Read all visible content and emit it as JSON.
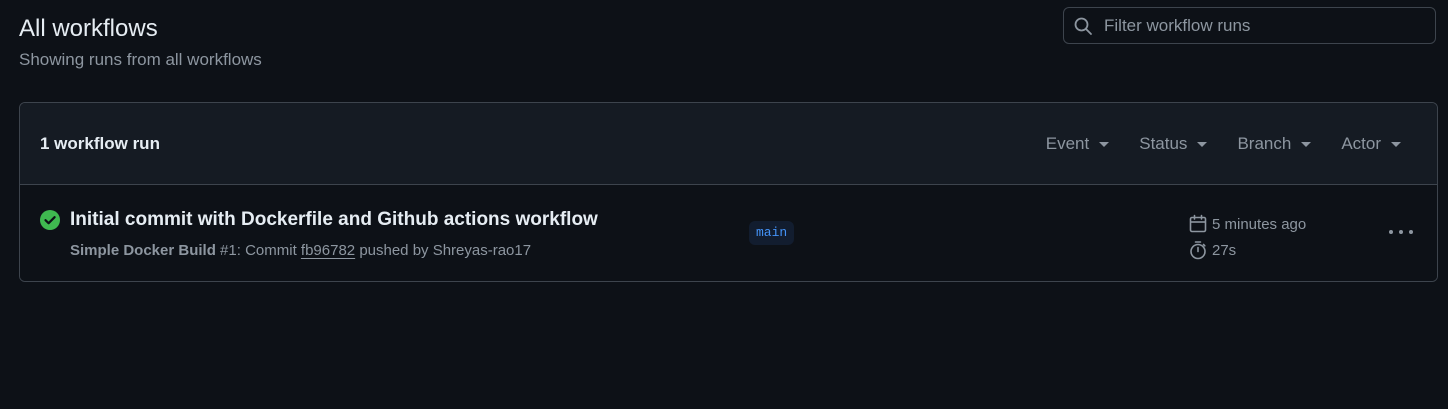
{
  "header": {
    "title": "All workflows",
    "subtitle": "Showing runs from all workflows"
  },
  "search": {
    "placeholder": "Filter workflow runs",
    "value": ""
  },
  "runs_header": {
    "count_label": "1 workflow run",
    "filters": [
      {
        "label": "Event"
      },
      {
        "label": "Status"
      },
      {
        "label": "Branch"
      },
      {
        "label": "Actor"
      }
    ]
  },
  "runs": [
    {
      "status": "success",
      "title": "Initial commit with Dockerfile and Github actions workflow",
      "workflow_name": "Simple Docker Build",
      "run_number": "#1",
      "meta_commit_prefix": ": Commit",
      "commit_sha": "fb96782",
      "meta_pushed_by": "pushed by Shreyas-rao17",
      "branch": "main",
      "time_ago": "5 minutes ago",
      "duration": "27s"
    }
  ],
  "colors": {
    "background": "#0d1117",
    "header_bg": "#151b23",
    "border": "#3d444d",
    "text_primary": "#e6edf3",
    "text_muted": "#8d96a0",
    "success": "#3fb950",
    "branch_bg": "#121d2f",
    "branch_text": "#4493f8"
  },
  "icons": {
    "search": "search-icon",
    "status": "check-circle-fill-icon",
    "calendar": "calendar-icon",
    "duration": "stopwatch-icon",
    "menu": "kebab-horizontal-icon",
    "caret": "triangle-down-icon"
  }
}
